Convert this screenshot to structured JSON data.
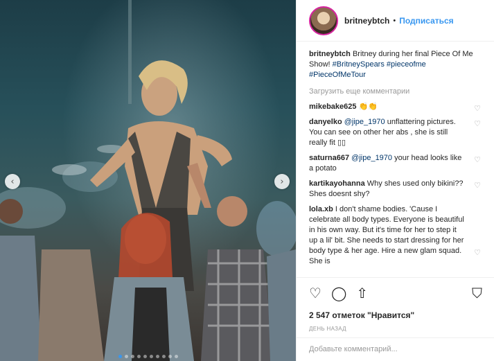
{
  "post": {
    "username": "britneybtch",
    "separator": "•",
    "follow_label": "Подписаться",
    "caption": {
      "username": "britneybtch",
      "text": " Britney during her final Piece Of Me Show! ",
      "tags": [
        "#BritneySpears",
        "#pieceofme",
        "#PieceOfMeTour"
      ]
    },
    "load_more": "Загрузить еще комментарии",
    "comments": [
      {
        "user": "mikebake625",
        "text": " 👏👏"
      },
      {
        "user": "danyelko",
        "mention": "@jipe_1970",
        "text": " unflattering pictures. You can see on other her abs , she is still really fit ▯▯"
      },
      {
        "user": "saturna667",
        "mention": "@jipe_1970",
        "text": " your head looks like a potato"
      },
      {
        "user": "kartikayohanna",
        "text": " Why shes used only bikini?? Shes doesnt shy?"
      },
      {
        "user": "lola.xb",
        "text": " I don't shame bodies. 'Cause I celebrate all body types. Everyone is beautiful in his own way. But it's time for her to step it up a lil' bit. She needs to start dressing for her body type & her age. Hire a new glam squad. She is"
      }
    ],
    "likes": "2 547 отметок \"Нравится\"",
    "time": "ДЕНЬ НАЗАД",
    "add_comment_placeholder": "Добавьте комментарий..."
  },
  "icons": {
    "like": "heart-icon",
    "comment": "comment-icon",
    "share": "share-icon",
    "save": "bookmark-icon",
    "prev": "chevron-left-icon",
    "next": "chevron-right-icon"
  },
  "carousel": {
    "total": 10,
    "active": 0
  },
  "colors": {
    "link": "#3897f0",
    "tag": "#003569",
    "muted": "#999999"
  }
}
